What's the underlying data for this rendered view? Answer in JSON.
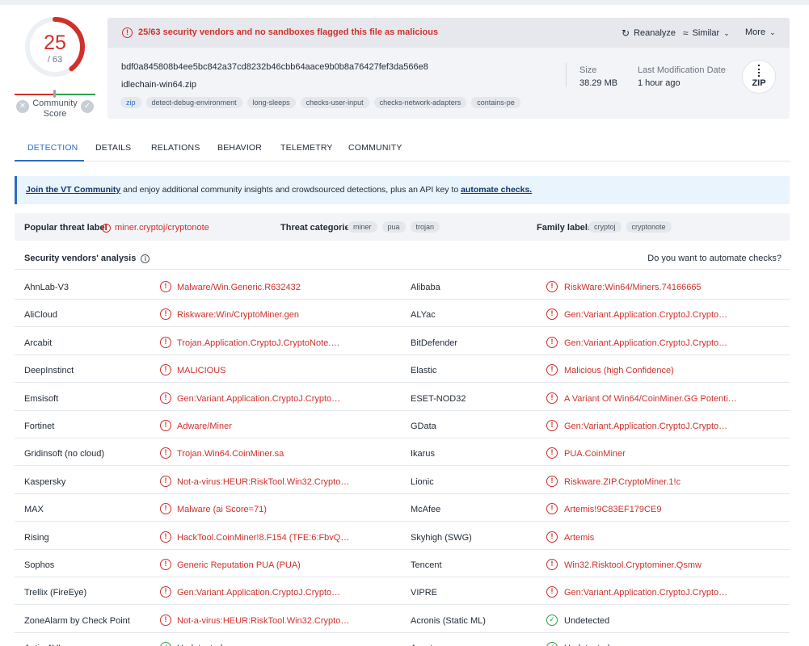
{
  "score": {
    "detected": "25",
    "total": "/ 63",
    "community_label": "Community\nScore"
  },
  "alert": "25/63 security vendors and no sandboxes flagged this file as malicious",
  "actions": {
    "reanalyze": "Reanalyze",
    "similar": "Similar",
    "more": "More"
  },
  "file": {
    "hash": "bdf0a845808b4ee5bc842a37cd8232b46cbb64aace9b0b8a76427fef3da566e8",
    "name": "idlechain-win64.zip",
    "tags": [
      "zip",
      "detect-debug-environment",
      "long-sleeps",
      "checks-user-input",
      "checks-network-adapters",
      "contains-pe"
    ],
    "size_label": "Size",
    "size": "38.29 MB",
    "modified_label": "Last Modification Date",
    "modified": "1 hour ago",
    "type_icon": "ZIP"
  },
  "tabs": [
    "DETECTION",
    "DETAILS",
    "RELATIONS",
    "BEHAVIOR",
    "TELEMETRY",
    "COMMUNITY"
  ],
  "banner": {
    "link1": "Join the VT Community",
    "middle": " and enjoy additional community insights and crowdsourced detections, plus an API key to ",
    "link2": "automate checks."
  },
  "threat": {
    "popular_label": "Popular threat label",
    "popular_value": "miner.cryptoj/cryptonote",
    "categories_label": "Threat categories",
    "categories": [
      "miner",
      "pua",
      "trojan"
    ],
    "family_label": "Family labels",
    "families": [
      "cryptoj",
      "cryptonote"
    ]
  },
  "analysis": {
    "title": "Security vendors' analysis",
    "cta": "Do you want to automate checks?"
  },
  "vendors": [
    [
      {
        "name": "AhnLab-V3",
        "result": "Malware/Win.Generic.R632432",
        "ok": false
      },
      {
        "name": "Alibaba",
        "result": "RiskWare:Win64/Miners.74166665",
        "ok": false
      }
    ],
    [
      {
        "name": "AliCloud",
        "result": "Riskware:Win/CryptoMiner.gen",
        "ok": false
      },
      {
        "name": "ALYac",
        "result": "Gen:Variant.Application.CryptoJ.Crypto…",
        "ok": false
      }
    ],
    [
      {
        "name": "Arcabit",
        "result": "Trojan.Application.CryptoJ.CryptoNote.…",
        "ok": false
      },
      {
        "name": "BitDefender",
        "result": "Gen:Variant.Application.CryptoJ.Crypto…",
        "ok": false
      }
    ],
    [
      {
        "name": "DeepInstinct",
        "result": "MALICIOUS",
        "ok": false
      },
      {
        "name": "Elastic",
        "result": "Malicious (high Confidence)",
        "ok": false
      }
    ],
    [
      {
        "name": "Emsisoft",
        "result": "Gen:Variant.Application.CryptoJ.Crypto…",
        "ok": false
      },
      {
        "name": "ESET-NOD32",
        "result": "A Variant Of Win64/CoinMiner.GG Potenti…",
        "ok": false
      }
    ],
    [
      {
        "name": "Fortinet",
        "result": "Adware/Miner",
        "ok": false
      },
      {
        "name": "GData",
        "result": "Gen:Variant.Application.CryptoJ.Crypto…",
        "ok": false
      }
    ],
    [
      {
        "name": "Gridinsoft (no cloud)",
        "result": "Trojan.Win64.CoinMiner.sa",
        "ok": false
      },
      {
        "name": "Ikarus",
        "result": "PUA.CoinMiner",
        "ok": false
      }
    ],
    [
      {
        "name": "Kaspersky",
        "result": "Not-a-virus:HEUR:RiskTool.Win32.Crypto…",
        "ok": false
      },
      {
        "name": "Lionic",
        "result": "Riskware.ZIP.CryptoMiner.1!c",
        "ok": false
      }
    ],
    [
      {
        "name": "MAX",
        "result": "Malware (ai Score=71)",
        "ok": false
      },
      {
        "name": "McAfee",
        "result": "Artemis!9C83EF179CE9",
        "ok": false
      }
    ],
    [
      {
        "name": "Rising",
        "result": "HackTool.CoinMiner!8.F154 (TFE:6:FbvQ…",
        "ok": false
      },
      {
        "name": "Skyhigh (SWG)",
        "result": "Artemis",
        "ok": false
      }
    ],
    [
      {
        "name": "Sophos",
        "result": "Generic Reputation PUA (PUA)",
        "ok": false
      },
      {
        "name": "Tencent",
        "result": "Win32.Risktool.Cryptominer.Qsmw",
        "ok": false
      }
    ],
    [
      {
        "name": "Trellix (FireEye)",
        "result": "Gen:Variant.Application.CryptoJ.Crypto…",
        "ok": false
      },
      {
        "name": "VIPRE",
        "result": "Gen:Variant.Application.CryptoJ.Crypto…",
        "ok": false
      }
    ],
    [
      {
        "name": "ZoneAlarm by Check Point",
        "result": "Not-a-virus:HEUR:RiskTool.Win32.Crypto…",
        "ok": false
      },
      {
        "name": "Acronis (Static ML)",
        "result": "Undetected",
        "ok": true
      }
    ],
    [
      {
        "name": "Antiy-AVL",
        "result": "Undetected",
        "ok": true
      },
      {
        "name": "Avast",
        "result": "Undetected",
        "ok": true
      }
    ]
  ],
  "colors": {
    "malicious": "#d0302b",
    "clean": "#2e9f4a",
    "accent": "#2c6cc4"
  }
}
